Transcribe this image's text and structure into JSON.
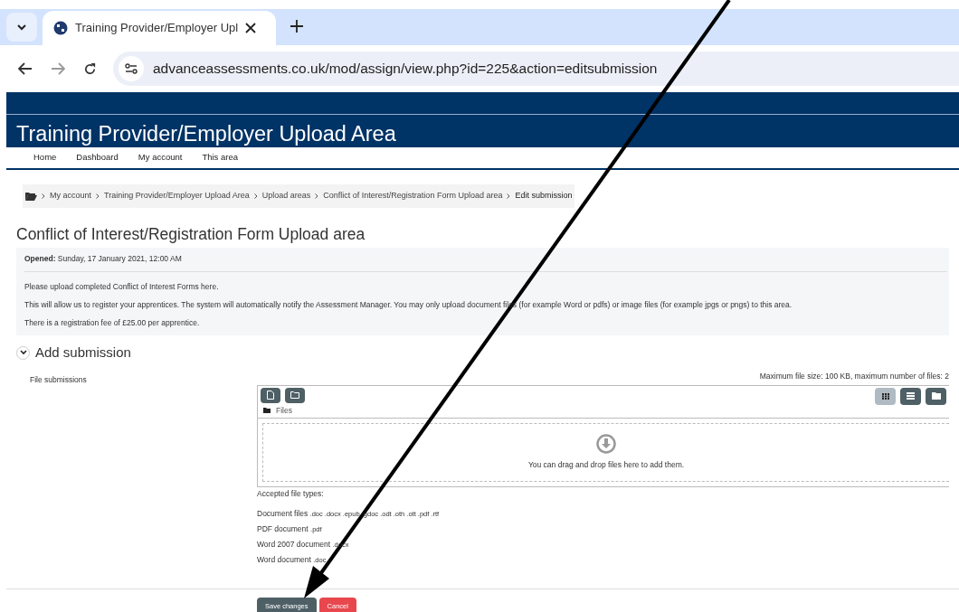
{
  "browser": {
    "tab_title": "Training Provider/Employer Upl",
    "url": "advanceassessments.co.uk/mod/assign/view.php?id=225&action=editsubmission"
  },
  "site_title": "Training Provider/Employer Upload Area",
  "nav": [
    "Home",
    "Dashboard",
    "My account",
    "This area"
  ],
  "breadcrumb": [
    "My account",
    "Training Provider/Employer Upload Area",
    "Upload areas",
    "Conflict of Interest/Registration Form Upload area",
    "Edit submission"
  ],
  "heading": "Conflict of Interest/Registration Form Upload area",
  "opened": {
    "label": "Opened:",
    "value": "Sunday, 17 January 2021, 12:00 AM"
  },
  "intro": [
    "Please upload completed Conflict of Interest Forms here.",
    "This will allow us to register your apprentices.  The system will automatically notify the Assessment Manager.  You may only upload document files (for example Word or pdfs) or image files (for example jpgs or pngs) to this area.",
    "There is a registration fee of £25.00 per apprentice."
  ],
  "section": {
    "title": "Add submission",
    "expanded": true
  },
  "field_label": "File submissions",
  "file_limits": "Maximum file size: 100 KB, maximum number of files: 2",
  "view_modes": [
    {
      "kind": "grid",
      "selected": true
    },
    {
      "kind": "list",
      "selected": false
    },
    {
      "kind": "tree",
      "selected": false
    }
  ],
  "folder_label": "Files",
  "drop_hint": "You can drag and drop files here to add them.",
  "accepted_label": "Accepted file types:",
  "file_types": [
    {
      "name": "Document files",
      "ext": ".doc .docx .epub .gdoc .odt .oth .ott .pdf .rtf"
    },
    {
      "name": "PDF document",
      "ext": ".pdf"
    },
    {
      "name": "Word 2007 document",
      "ext": ".docx"
    },
    {
      "name": "Word document",
      "ext": ".doc"
    }
  ],
  "buttons": [
    {
      "label": "Save changes",
      "kind": "primary"
    },
    {
      "label": "Cancel",
      "kind": "danger"
    }
  ]
}
